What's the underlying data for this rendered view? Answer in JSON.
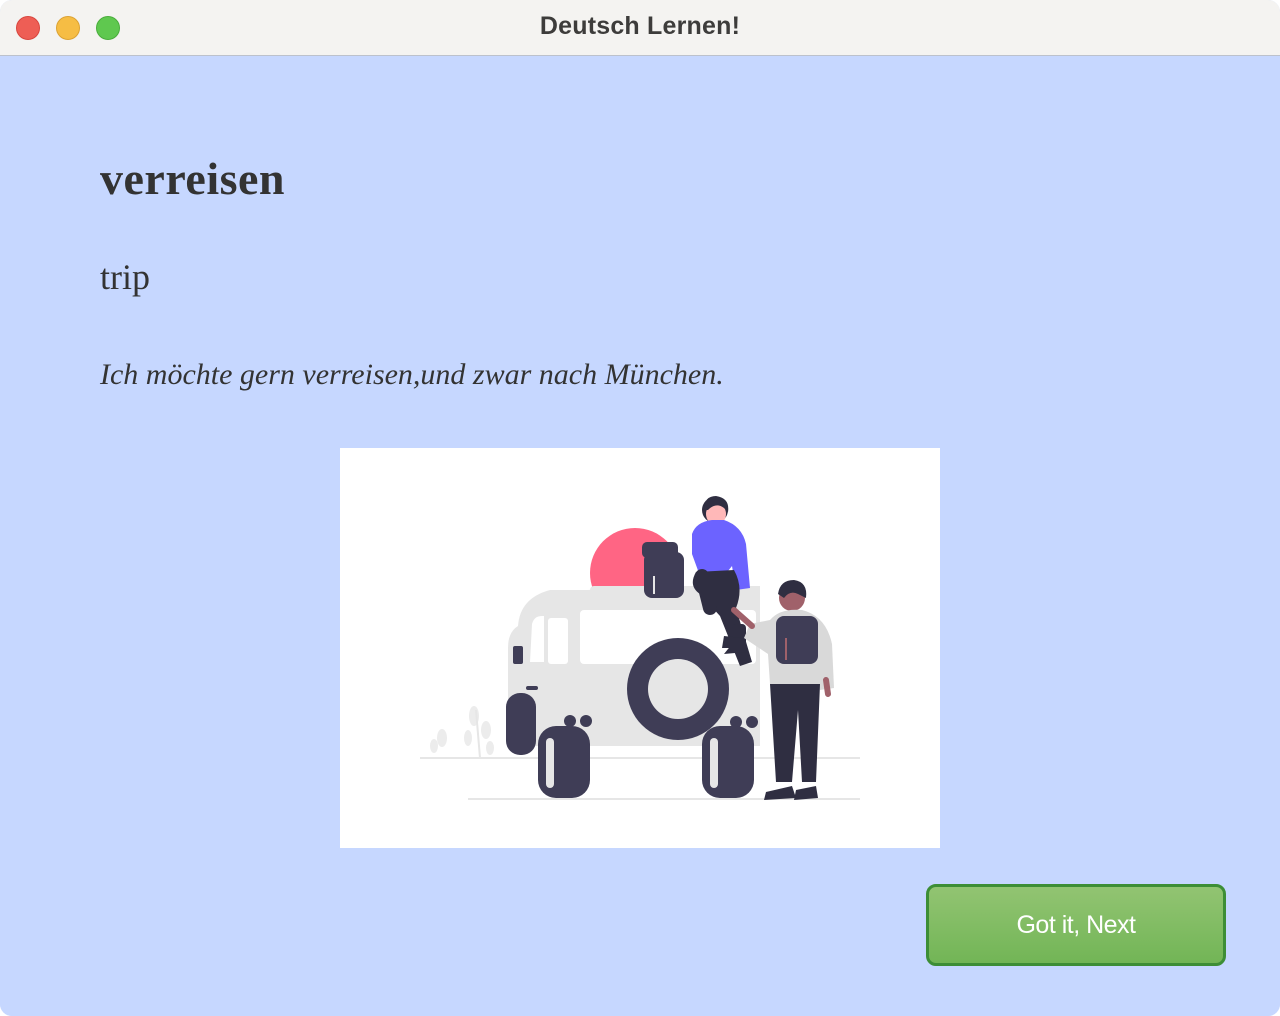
{
  "window": {
    "title": "Deutsch Lernen!"
  },
  "card": {
    "word": "verreisen",
    "translation": "trip",
    "example": "Ich möchte gern verreisen,und zwar nach München.",
    "illustration_icon": "travel-car-illustration"
  },
  "actions": {
    "next_label": "Got it, Next"
  },
  "colors": {
    "background": "#c6d7ff",
    "button": "#7fbc63",
    "button_border": "#3d8e36",
    "accent_purple": "#6c63ff",
    "accent_pink": "#ff6584",
    "dark": "#3f3d56"
  }
}
